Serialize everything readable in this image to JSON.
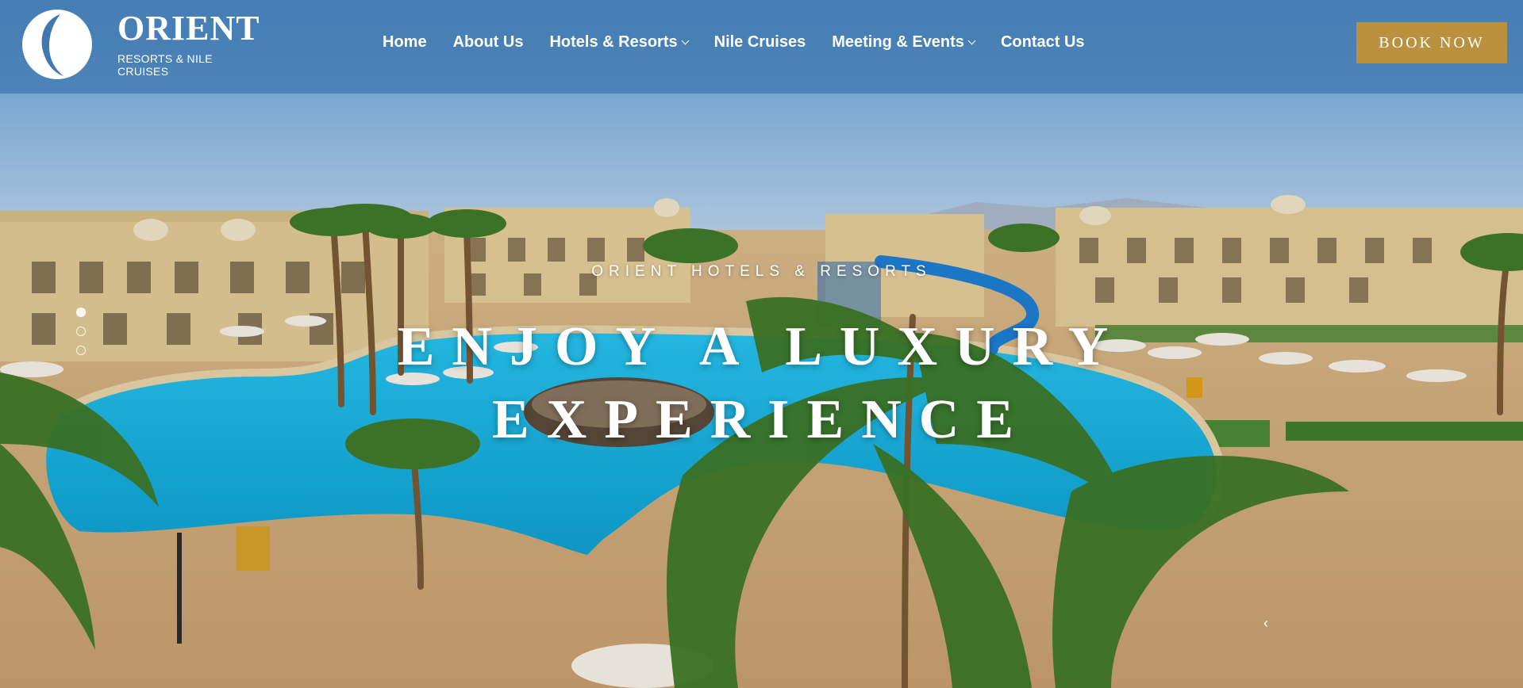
{
  "header": {
    "logo": {
      "name": "ORIENT",
      "subtitle": "RESORTS & NILE CRUISES"
    },
    "nav": [
      {
        "label": "Home",
        "has_dropdown": false
      },
      {
        "label": "About Us",
        "has_dropdown": false
      },
      {
        "label": "Hotels & Resorts",
        "has_dropdown": true
      },
      {
        "label": "Nile Cruises",
        "has_dropdown": false
      },
      {
        "label": "Meeting & Events",
        "has_dropdown": true
      },
      {
        "label": "Contact Us",
        "has_dropdown": false
      }
    ],
    "book_button": "BOOK NOW"
  },
  "hero": {
    "kicker": "ORIENT HOTELS & RESORTS",
    "title_line_1": "ENJOY A LUXURY",
    "title_line_2": "EXPERIENCE",
    "slides_count": 3,
    "active_slide": 1
  },
  "colors": {
    "header_bg": "#4078af",
    "accent_gold": "#b9913f",
    "pool": "#1fb6e0",
    "sky": "#8db8e3",
    "sand": "#e6cfa1"
  },
  "icons": {
    "caret": "chevron-down-icon",
    "prev": "chevron-left-icon"
  }
}
